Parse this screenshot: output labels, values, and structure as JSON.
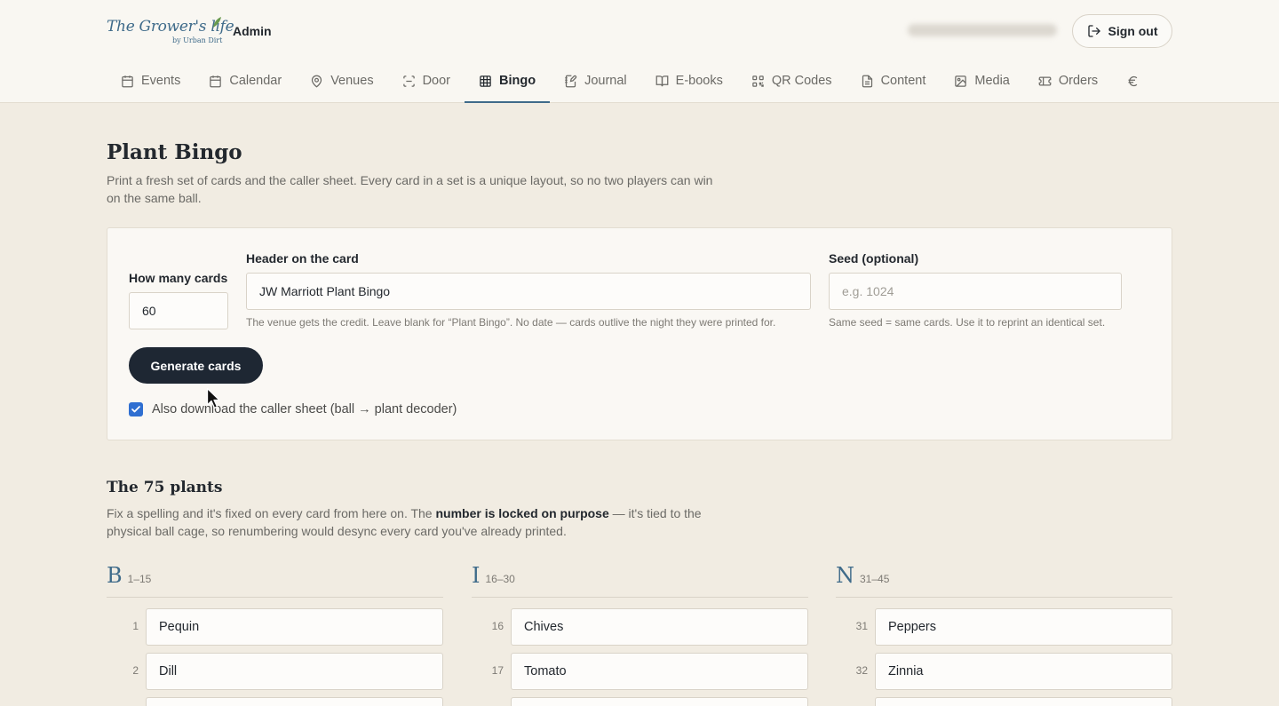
{
  "brand": {
    "logo_text": "The Grower's life",
    "logo_sub": "by Urban Dirt",
    "section": "Admin"
  },
  "header": {
    "sign_out": "Sign out"
  },
  "nav": {
    "tabs": [
      {
        "label": "Events",
        "icon": "calendar-icon"
      },
      {
        "label": "Calendar",
        "icon": "calendar-icon"
      },
      {
        "label": "Venues",
        "icon": "map-pin-icon"
      },
      {
        "label": "Door",
        "icon": "scan-icon"
      },
      {
        "label": "Bingo",
        "icon": "grid-icon",
        "active": true
      },
      {
        "label": "Journal",
        "icon": "notebook-pen-icon"
      },
      {
        "label": "E-books",
        "icon": "book-open-icon"
      },
      {
        "label": "QR Codes",
        "icon": "qr-code-icon"
      },
      {
        "label": "Content",
        "icon": "file-text-icon"
      },
      {
        "label": "Media",
        "icon": "image-icon"
      },
      {
        "label": "Orders",
        "icon": "ticket-icon"
      }
    ]
  },
  "page": {
    "title": "Plant Bingo",
    "intro": "Print a fresh set of cards and the caller sheet. Every card in a set is a unique layout, so no two players can win on the same ball."
  },
  "generator": {
    "count_label": "How many cards",
    "count_value": "60",
    "header_label": "Header on the card",
    "header_value": "JW Marriott Plant Bingo",
    "header_help": "The venue gets the credit. Leave blank for “Plant Bingo”. No date — cards outlive the night they were printed for.",
    "seed_label": "Seed (optional)",
    "seed_placeholder": "e.g. 1024",
    "seed_help": "Same seed = same cards. Use it to reprint an identical set.",
    "generate_button": "Generate cards",
    "caller_sheet_label": "Also download the caller sheet (ball → plant decoder)",
    "caller_sheet_checked": true
  },
  "plants": {
    "title": "The 75 plants",
    "intro_before": "Fix a spelling and it's fixed on every card from here on. The ",
    "intro_bold": "number is locked on purpose",
    "intro_after": " — it's tied to the physical ball cage, so renumbering would desync every card you've already printed.",
    "columns": [
      {
        "letter": "B",
        "range": "1–15",
        "rows": [
          {
            "num": "1",
            "name": "Pequin"
          },
          {
            "num": "2",
            "name": "Dill"
          }
        ]
      },
      {
        "letter": "I",
        "range": "16–30",
        "rows": [
          {
            "num": "16",
            "name": "Chives"
          },
          {
            "num": "17",
            "name": "Tomato"
          }
        ]
      },
      {
        "letter": "N",
        "range": "31–45",
        "rows": [
          {
            "num": "31",
            "name": "Peppers"
          },
          {
            "num": "32",
            "name": "Zinnia"
          }
        ]
      }
    ]
  },
  "colors": {
    "accent": "#3f6b8a",
    "primary_button": "#1e2733",
    "background": "#f1ece2",
    "checkbox": "#2f6fd1"
  }
}
